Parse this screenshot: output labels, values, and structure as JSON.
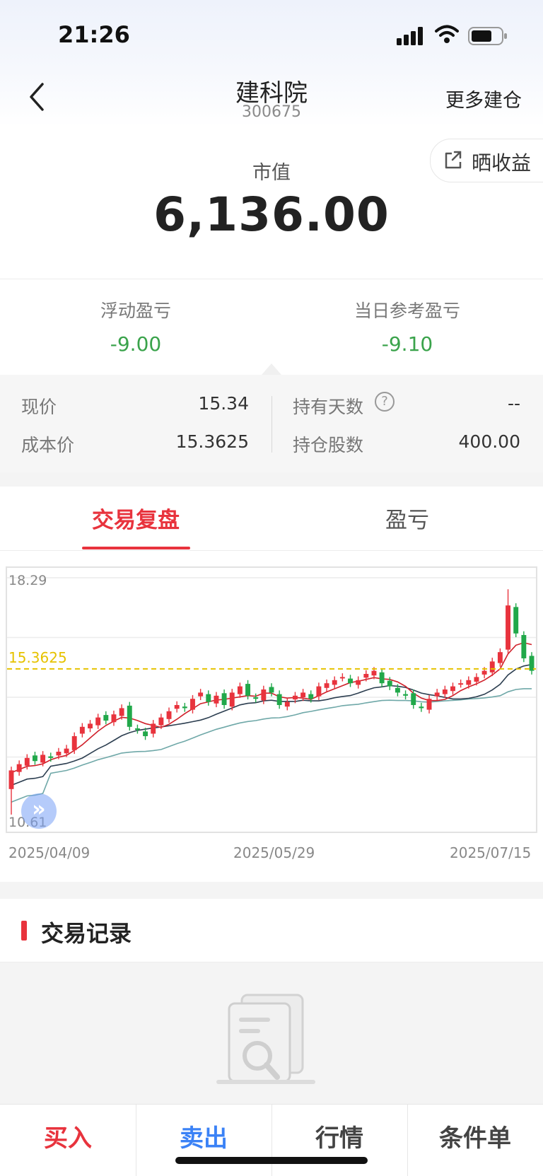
{
  "status_bar": {
    "time": "21:26"
  },
  "header": {
    "stock_name": "建科院",
    "stock_code": "300675",
    "more_label": "更多建仓"
  },
  "share": {
    "label": "晒收益"
  },
  "market_value": {
    "label": "市值",
    "value": "6,136.00"
  },
  "pl": {
    "floating_label": "浮动盈亏",
    "floating_value": "-9.00",
    "daily_label": "当日参考盈亏",
    "daily_value": "-9.10"
  },
  "details": {
    "current_price_label": "现价",
    "current_price": "15.34",
    "cost_price_label": "成本价",
    "cost_price": "15.3625",
    "holding_days_label": "持有天数",
    "holding_days": "--",
    "shares_label": "持仓股数",
    "shares": "400.00",
    "help_glyph": "?"
  },
  "tabs": [
    {
      "label": "交易复盘",
      "active": true
    },
    {
      "label": "盈亏",
      "active": false
    }
  ],
  "chart": {
    "y_max_label": "18.29",
    "y_min_label": "10.61",
    "cost_line_label": "15.3625",
    "x_labels": [
      "2025/04/09",
      "2025/05/29",
      "2025/07/15"
    ],
    "expand_glyph": "»"
  },
  "chart_data": {
    "type": "candlestick",
    "ylim": [
      10.61,
      18.29
    ],
    "x_start": "2025/04/09",
    "x_mid": "2025/05/29",
    "x_end": "2025/07/15",
    "reference_line": 15.3625,
    "closes": [
      12.1,
      12.3,
      12.5,
      12.4,
      12.6,
      12.5,
      12.7,
      12.8,
      13.2,
      13.5,
      13.6,
      13.8,
      13.7,
      13.9,
      14.1,
      13.5,
      13.4,
      13.2,
      13.6,
      13.8,
      14.0,
      14.2,
      14.1,
      14.4,
      14.6,
      14.3,
      14.5,
      14.2,
      14.6,
      14.8,
      14.5,
      14.4,
      14.7,
      14.6,
      14.2,
      14.3,
      14.5,
      14.6,
      14.4,
      14.8,
      14.9,
      15.0,
      15.1,
      14.9,
      15.0,
      15.2,
      15.3,
      14.9,
      14.8,
      14.6,
      14.5,
      14.2,
      14.1,
      14.4,
      14.6,
      14.7,
      14.8,
      14.9,
      15.0,
      15.1,
      15.3,
      15.6,
      15.9,
      17.4,
      16.5,
      15.7,
      15.3
    ]
  },
  "trade_records": {
    "title": "交易记录"
  },
  "bottom_bar": {
    "buy": "买入",
    "sell": "卖出",
    "quote": "行情",
    "conditional": "条件单"
  },
  "colors": {
    "up": "#e8333d",
    "down": "#21a84a",
    "cost_line": "#e6c200",
    "accent": "#e8333d",
    "sell": "#3b82f6",
    "profit_green": "#3aa34b"
  }
}
